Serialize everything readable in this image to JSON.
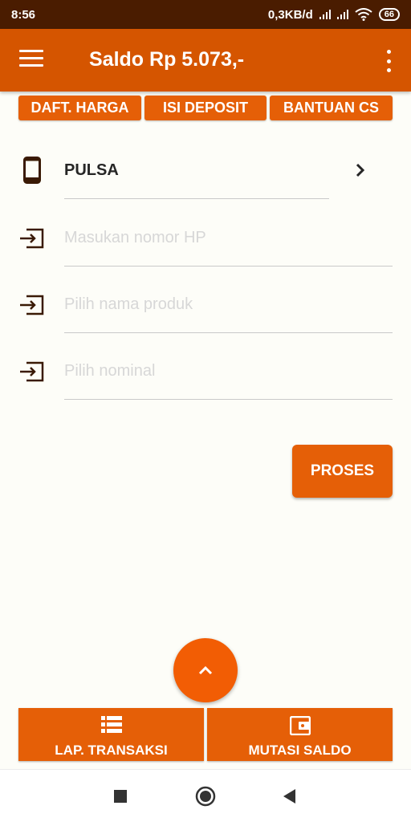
{
  "status_bar": {
    "time": "8:56",
    "network_speed": "0,3KB/d",
    "battery": "66"
  },
  "app_bar": {
    "title": "Saldo Rp 5.073,-",
    "menu_icon": "hamburger-menu-icon",
    "overflow_icon": "more-vert-icon"
  },
  "top_buttons": [
    {
      "label": "DAFT. HARGA"
    },
    {
      "label": "ISI DEPOSIT"
    },
    {
      "label": "BANTUAN CS"
    }
  ],
  "form": {
    "category": {
      "icon": "smartphone-icon",
      "label": "PULSA",
      "chevron": "chevron-right-icon"
    },
    "phone_placeholder": "Masukan nomor HP",
    "product_placeholder": "Pilih nama produk",
    "nominal_placeholder": "Pilih nominal",
    "field_icon": "input-arrow-icon"
  },
  "proses_button": {
    "label": "PROSES"
  },
  "fab": {
    "icon": "chevron-up-icon"
  },
  "bottom_buttons": [
    {
      "label": "LAP. TRANSAKSI",
      "icon": "list-icon"
    },
    {
      "label": "MUTASI SALDO",
      "icon": "wallet-icon"
    }
  ],
  "colors": {
    "status_bar": "#4a1c00",
    "app_bar": "#d55500",
    "accent": "#e55f07",
    "fab": "#f25d04",
    "background": "#fdfdf8",
    "icon_dark": "#3a1a05"
  }
}
